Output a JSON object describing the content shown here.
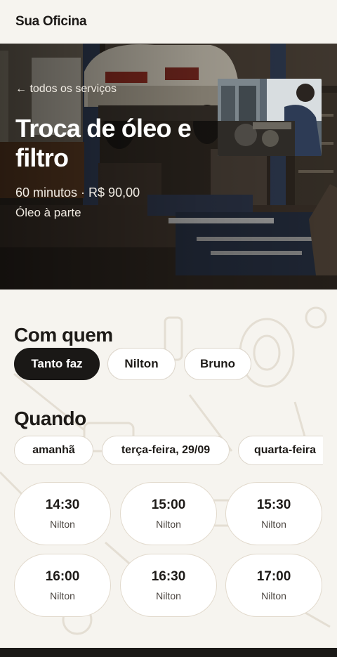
{
  "header": {
    "brand": "Sua Oficina"
  },
  "hero": {
    "back_link": "← todos os serviços",
    "title": "Troca de óleo e filtro",
    "meta": "60 minutos · R$ 90,00",
    "note": "Óleo à parte"
  },
  "with_whom": {
    "title": "Com quem",
    "options": [
      {
        "label": "Tanto faz",
        "selected": true
      },
      {
        "label": "Nilton",
        "selected": false
      },
      {
        "label": "Bruno",
        "selected": false
      }
    ]
  },
  "when": {
    "title": "Quando",
    "dates": [
      {
        "label": "amanhã"
      },
      {
        "label": "terça-feira, 29/09"
      },
      {
        "label": "quarta-feira"
      }
    ],
    "slots": [
      {
        "time": "14:30",
        "who": "Nilton"
      },
      {
        "time": "15:00",
        "who": "Nilton"
      },
      {
        "time": "15:30",
        "who": "Nilton"
      },
      {
        "time": "16:00",
        "who": "Nilton"
      },
      {
        "time": "16:30",
        "who": "Nilton"
      },
      {
        "time": "17:00",
        "who": "Nilton"
      }
    ]
  },
  "colors": {
    "dark": "#1a1816",
    "background": "#f6f4ef",
    "chip_border": "#ddd6cb"
  }
}
